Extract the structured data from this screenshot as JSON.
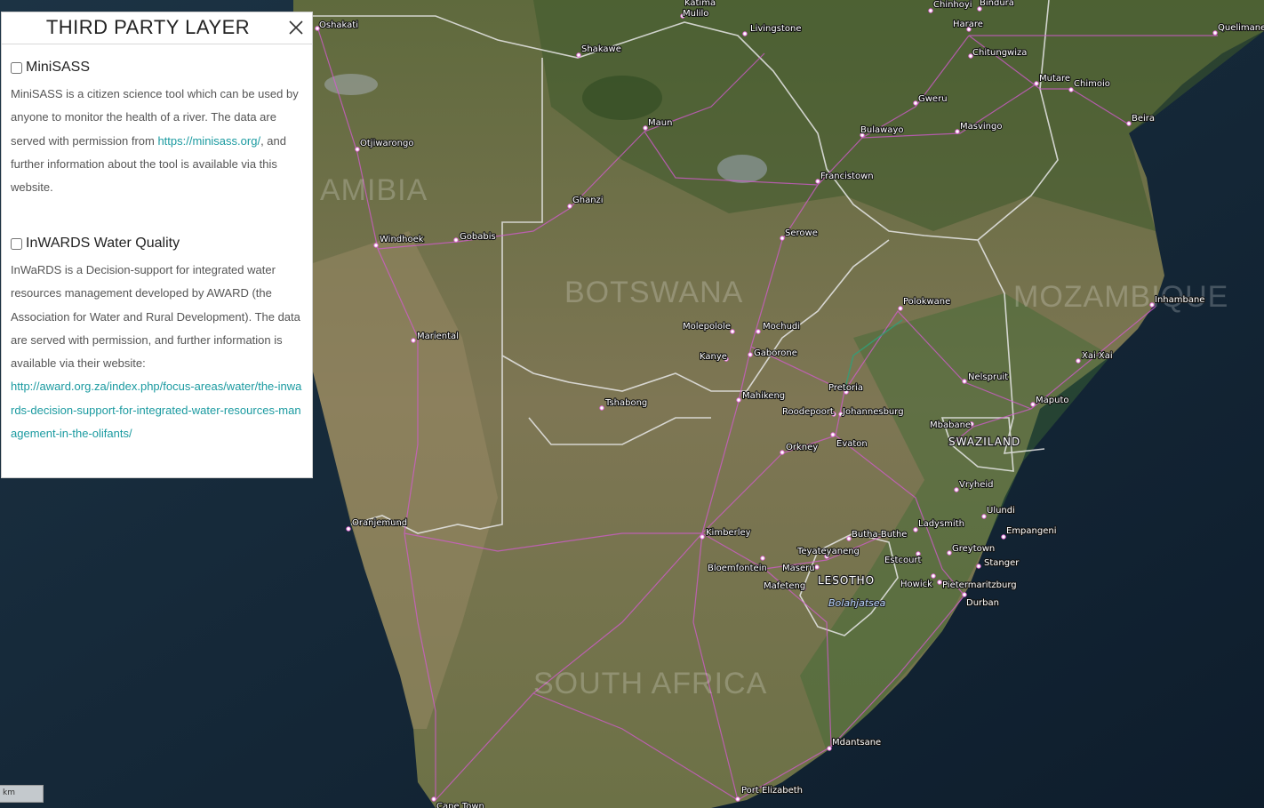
{
  "panel": {
    "title": "THIRD PARTY LAYER",
    "layers": [
      {
        "name": "MiniSASS",
        "checked": false,
        "desc_before": "MiniSASS is a citizen science tool which can be used by anyone to monitor the health of a river. The data are served with permission from ",
        "link": "https://minisass.org/",
        "desc_after": ", and further information about the tool is available via this website."
      },
      {
        "name": "InWARDS Water Quality",
        "checked": false,
        "desc_before": "InWaRDS is a Decision-support for integrated water resources management developed by AWARD (the Association for Water and Rural Development). The data are served with permission, and further information is available via their website:",
        "link": "http://award.org.za/index.php/focus-areas/water/the-inwards-decision-support-for-integrated-water-resources-management-in-the-olifants/",
        "desc_after": ""
      }
    ]
  },
  "map": {
    "scale_label": "km",
    "countries": [
      "NAMIBIA",
      "BOTSWANA",
      "MOZAMBIQUE",
      "SOUTH AFRICA",
      "SWAZILAND",
      "LESOTHO"
    ],
    "water": "Bolahjatsea",
    "cities": [
      "Oshakati",
      "Katima Mulilo",
      "Livingstone",
      "Chinhoyi",
      "Bindura",
      "Harare",
      "Chitungwiza",
      "Quelimane",
      "Shakawe",
      "Maun",
      "Gweru",
      "Mutare",
      "Chimoio",
      "Beira",
      "Bulawayo",
      "Masvingo",
      "Otjiwarongo",
      "Francistown",
      "Ghanzi",
      "Serowe",
      "Windhoek",
      "Gobabis",
      "Polokwane",
      "Inhambane",
      "Molepolole",
      "Mochudi",
      "Kanye",
      "Gaborone",
      "Mariental",
      "Xai-Xai",
      "Nelspruit",
      "Pretoria",
      "Mahikeng",
      "Tshabong",
      "Roodepoort",
      "Johannesburg",
      "Maputo",
      "Mbabane",
      "Evaton",
      "Orkney",
      "Vryheid",
      "Ulundi",
      "Oranjemund",
      "Ladysmith",
      "Kimberley",
      "Butha-Buthe",
      "Empangeni",
      "Greytown",
      "Teyateyaneng",
      "Estcourt",
      "Stanger",
      "Bloemfontein",
      "Maseru",
      "Mafeteng",
      "Howick",
      "Pietermaritzburg",
      "Durban",
      "Mdantsane",
      "Port Elizabeth",
      "Cape Town"
    ]
  }
}
